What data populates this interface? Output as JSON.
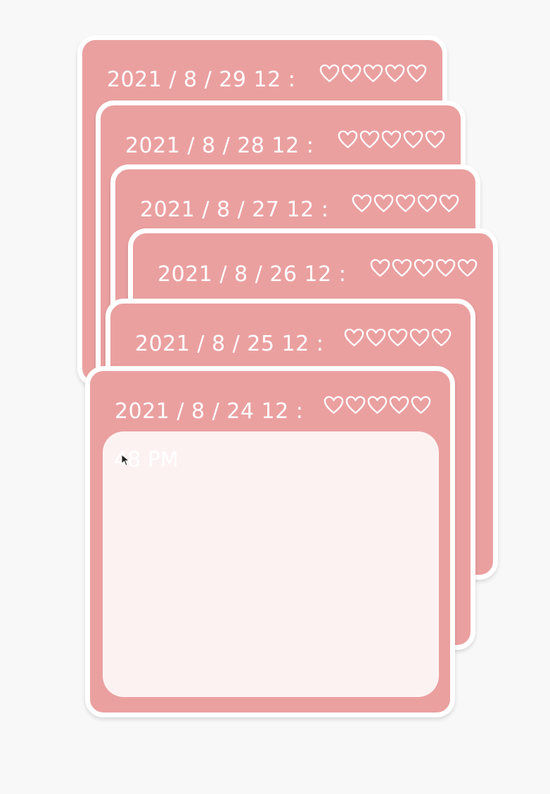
{
  "cards": [
    {
      "date": "2021 / 8 / 29 12 :"
    },
    {
      "date": "2021 / 8 / 28 12 :"
    },
    {
      "date": "2021 / 8 / 27 12 :"
    },
    {
      "date": "2021 / 8 / 26 12 :"
    },
    {
      "date": "2021 / 8 / 25 12 :"
    },
    {
      "date": "2021 / 8 / 24 12 :",
      "note": "48 PM"
    }
  ],
  "rating_icons": "heart-outline",
  "colors": {
    "card": "#eba0a0",
    "border": "#ffffff",
    "note_area": "#fdf2f2",
    "background": "#f8f8f9"
  }
}
